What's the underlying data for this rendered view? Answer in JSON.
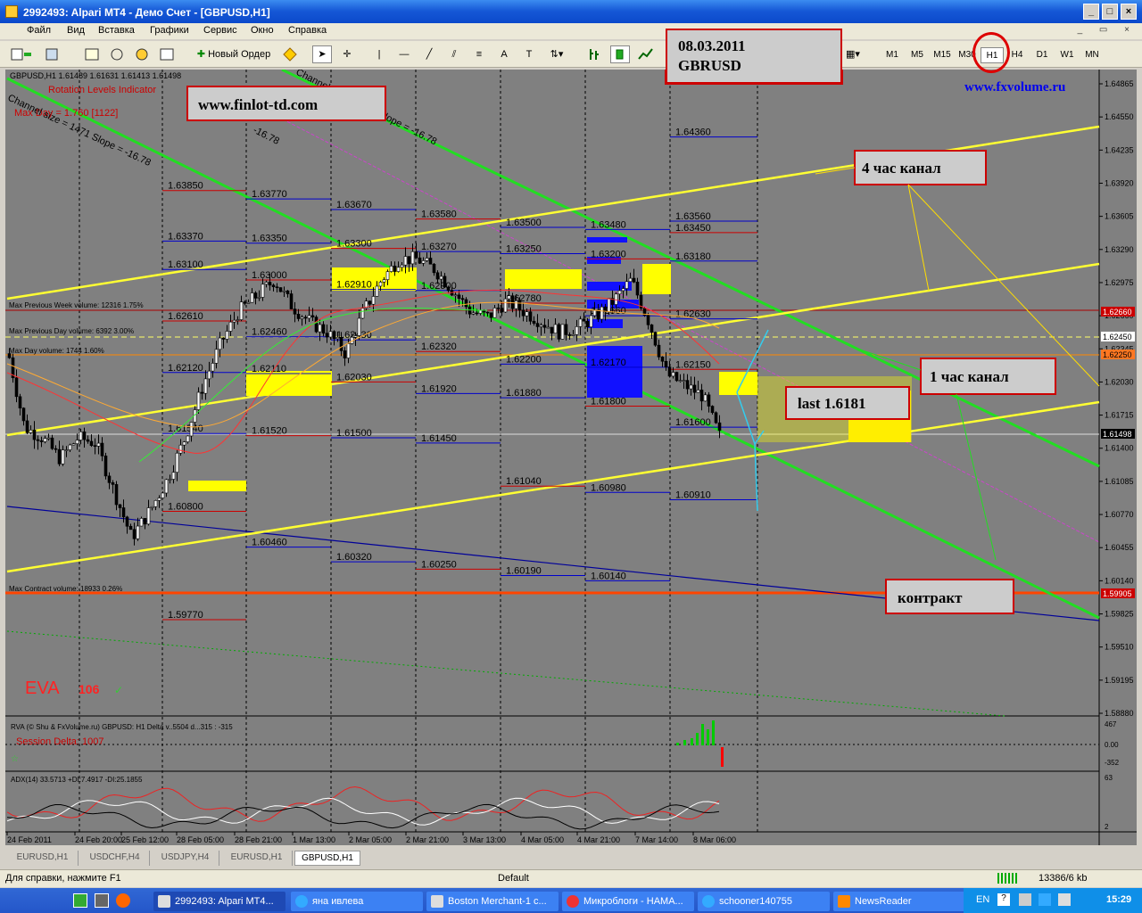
{
  "window": {
    "title": "2992493: Alpari MT4 - Демо Счет - [GBPUSD,H1]"
  },
  "menu": [
    "Файл",
    "Вид",
    "Вставка",
    "Графики",
    "Сервис",
    "Окно",
    "Справка"
  ],
  "toolbar": {
    "new_order_label": "Новый Ордер",
    "text_tool": "A",
    "label_tool": "T"
  },
  "timeframes": [
    {
      "label": "M1"
    },
    {
      "label": "M5"
    },
    {
      "label": "M15"
    },
    {
      "label": "M30"
    },
    {
      "label": "H1",
      "active": true
    },
    {
      "label": "H4"
    },
    {
      "label": "D1"
    },
    {
      "label": "W1"
    },
    {
      "label": "MN"
    }
  ],
  "chart": {
    "header": "GBPUSD,H1  1.61489 1.61631 1.61413 1.61498",
    "indicator_label": "Rotation Levels Indicator",
    "max_day_label": "Max Day = 1.760 [1122]",
    "channel_label": "Channel size = 1471 Slope = -16.78",
    "channel_label2": "Channel size = 1471 Slope = -16.78",
    "slope_label": "-16.78",
    "max_prev_week": "Max Previous Week volume: 12316 1.75%",
    "max_prev_day": "Max Previous Day volume: 6392 3.00%",
    "max_day_volume": "Max Day volume: 1744 1.60%",
    "max_contract": "Max Contract volume: 18933 0.26%",
    "eva_label": "EVA",
    "eva_value": "106",
    "price_axis": [
      "1.64865",
      "1.64550",
      "1.64235",
      "1.63920",
      "1.63605",
      "1.63290",
      "1.62975",
      "1.62660",
      "1.62345",
      "1.62030",
      "1.61715",
      "1.61400",
      "1.61085",
      "1.60770",
      "1.60455",
      "1.60140",
      "1.59825",
      "1.59510",
      "1.59195",
      "1.58880"
    ],
    "current_price": "1.61498",
    "price_tag_top": "1.62450",
    "price_tag_orange": "1.62250",
    "price_tag_red": "1.59905",
    "price_tag_red2": "1.62660",
    "time_axis": [
      "24 Feb 2011",
      "24 Feb 20:00",
      "25 Feb 12:00",
      "28 Feb 05:00",
      "28 Feb 21:00",
      "1 Mar 13:00",
      "2 Mar 05:00",
      "2 Mar 21:00",
      "3 Mar 13:00",
      "4 Mar 05:00",
      "4 Mar 21:00",
      "7 Mar 14:00",
      "8 Mar 06:00"
    ],
    "levels": [
      "1.63850",
      "1.63770",
      "1.63670",
      "1.63580",
      "1.63500",
      "1.63480",
      "1.63450",
      "1.63370",
      "1.63350",
      "1.63300",
      "1.63270",
      "1.63250",
      "1.63200",
      "1.63180",
      "1.63100",
      "1.63000",
      "1.62910",
      "1.62900",
      "1.62780",
      "1.62660",
      "1.62630",
      "1.62610",
      "1.62460",
      "1.62430",
      "1.62320",
      "1.62200",
      "1.62170",
      "1.62150",
      "1.62120",
      "1.62110",
      "1.62030",
      "1.61920",
      "1.61880",
      "1.61800",
      "1.61600",
      "1.61540",
      "1.61520",
      "1.61500",
      "1.61450",
      "1.61040",
      "1.60980",
      "1.60910",
      "1.60800",
      "1.60460",
      "1.60320",
      "1.60250",
      "1.60190",
      "1.60140",
      "1.59770",
      "1.64360",
      "1.63560"
    ],
    "sub1": {
      "label": "RVA (© Shu & FxVolume.ru) GBPUSD: H1 Delta  v..5504 d...315 : -315",
      "session_delta": "Session Delta: 1007",
      "axis": [
        "467",
        "0.00",
        "-352"
      ]
    },
    "sub2": {
      "label": "ADX(14) 33.5713 +DI:7.4917 -DI:25.1855",
      "axis_top": "63",
      "axis_bottom": "2"
    }
  },
  "annotations": {
    "date_box": {
      "line1": "08.03.2011",
      "line2": "GBRUSD"
    },
    "site": "www.finlot-td.com",
    "fxvolume": "www.fxvolume.ru",
    "channel4": "4 час канал",
    "channel1": "1 час канал",
    "last": "last 1.6181",
    "contract": "контракт"
  },
  "tabs": [
    {
      "label": "EURUSD,H1"
    },
    {
      "label": "USDCHF,H4"
    },
    {
      "label": "USDJPY,H4"
    },
    {
      "label": "EURUSD,H1"
    },
    {
      "label": "GBPUSD,H1",
      "active": true
    }
  ],
  "status": {
    "help": "Для справки, нажмите F1",
    "profile": "Default",
    "traffic": "13386/6 kb"
  },
  "taskbar": {
    "items": [
      {
        "label": "2992493: Alpari MT4...",
        "active": true
      },
      {
        "label": "яна ивлева"
      },
      {
        "label": "Boston Merchant-1 c..."
      },
      {
        "label": "Микроблоги - НАМА..."
      },
      {
        "label": "schooner140755"
      },
      {
        "label": "NewsReader"
      }
    ],
    "lang": "EN",
    "clock": "15:29"
  },
  "colors": {
    "chart_bg": "#808080",
    "candle": "#000000",
    "channel_green": "#22dd22",
    "channel_yellow": "#ffff33",
    "level_line": "#0000cc",
    "red_level": "#cc0000",
    "orange": "#ff6600"
  }
}
